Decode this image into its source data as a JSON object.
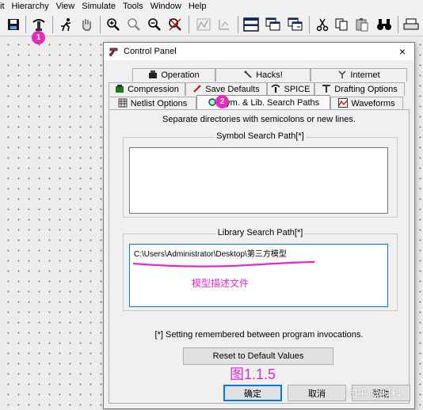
{
  "menubar": {
    "items": [
      "it",
      "Hierarchy",
      "View",
      "Simulate",
      "Tools",
      "Window",
      "Help"
    ]
  },
  "toolbar": {
    "icons": [
      "save-icon",
      "hierarchy-icon",
      "run-icon",
      "pan-hand-icon",
      "zoom-in-icon",
      "zoom-out-icon",
      "zoom-fit-icon",
      "zoom-cancel-icon",
      "autorange-icon",
      "autorange-y-icon",
      "tile-horizontal-icon",
      "cascade-icon",
      "tile-vertical-icon",
      "cut-icon",
      "copy-icon",
      "paste-icon",
      "find-icon",
      "print-icon"
    ]
  },
  "badges": {
    "b1": "1",
    "b2": "2"
  },
  "dialog": {
    "title": "Control Panel",
    "close": "×",
    "tabs_row1": [
      "Operation",
      "Hacks!",
      "Internet"
    ],
    "tabs_row2": [
      "Compression",
      "Save Defaults",
      "SPICE",
      "Drafting Options"
    ],
    "tabs_row3": [
      "Netlist Options",
      "Sym. & Lib. Search Paths",
      "Waveforms"
    ],
    "instruction": "Separate directories with semicolons or new lines.",
    "symbol_group_label": "Symbol Search Path[*]",
    "symbol_path_value": "",
    "library_group_label": "Library Search Path[*]",
    "library_path_value": "C:\\Users\\Administrator\\Desktop\\第三方模型",
    "annotation_text": "模型描述文件",
    "remember_note": "[*] Setting remembered between program invocations.",
    "reset_button": "Reset to Default Values",
    "figure_caption": "图1.1.5",
    "ok_button": "确定",
    "cancel_button": "取消",
    "help_button": "帮助"
  },
  "watermark": "知乎 @科科",
  "colors": {
    "annotation": "#e02bd0",
    "badge": "#e62ab9",
    "accent": "#0078d7"
  }
}
